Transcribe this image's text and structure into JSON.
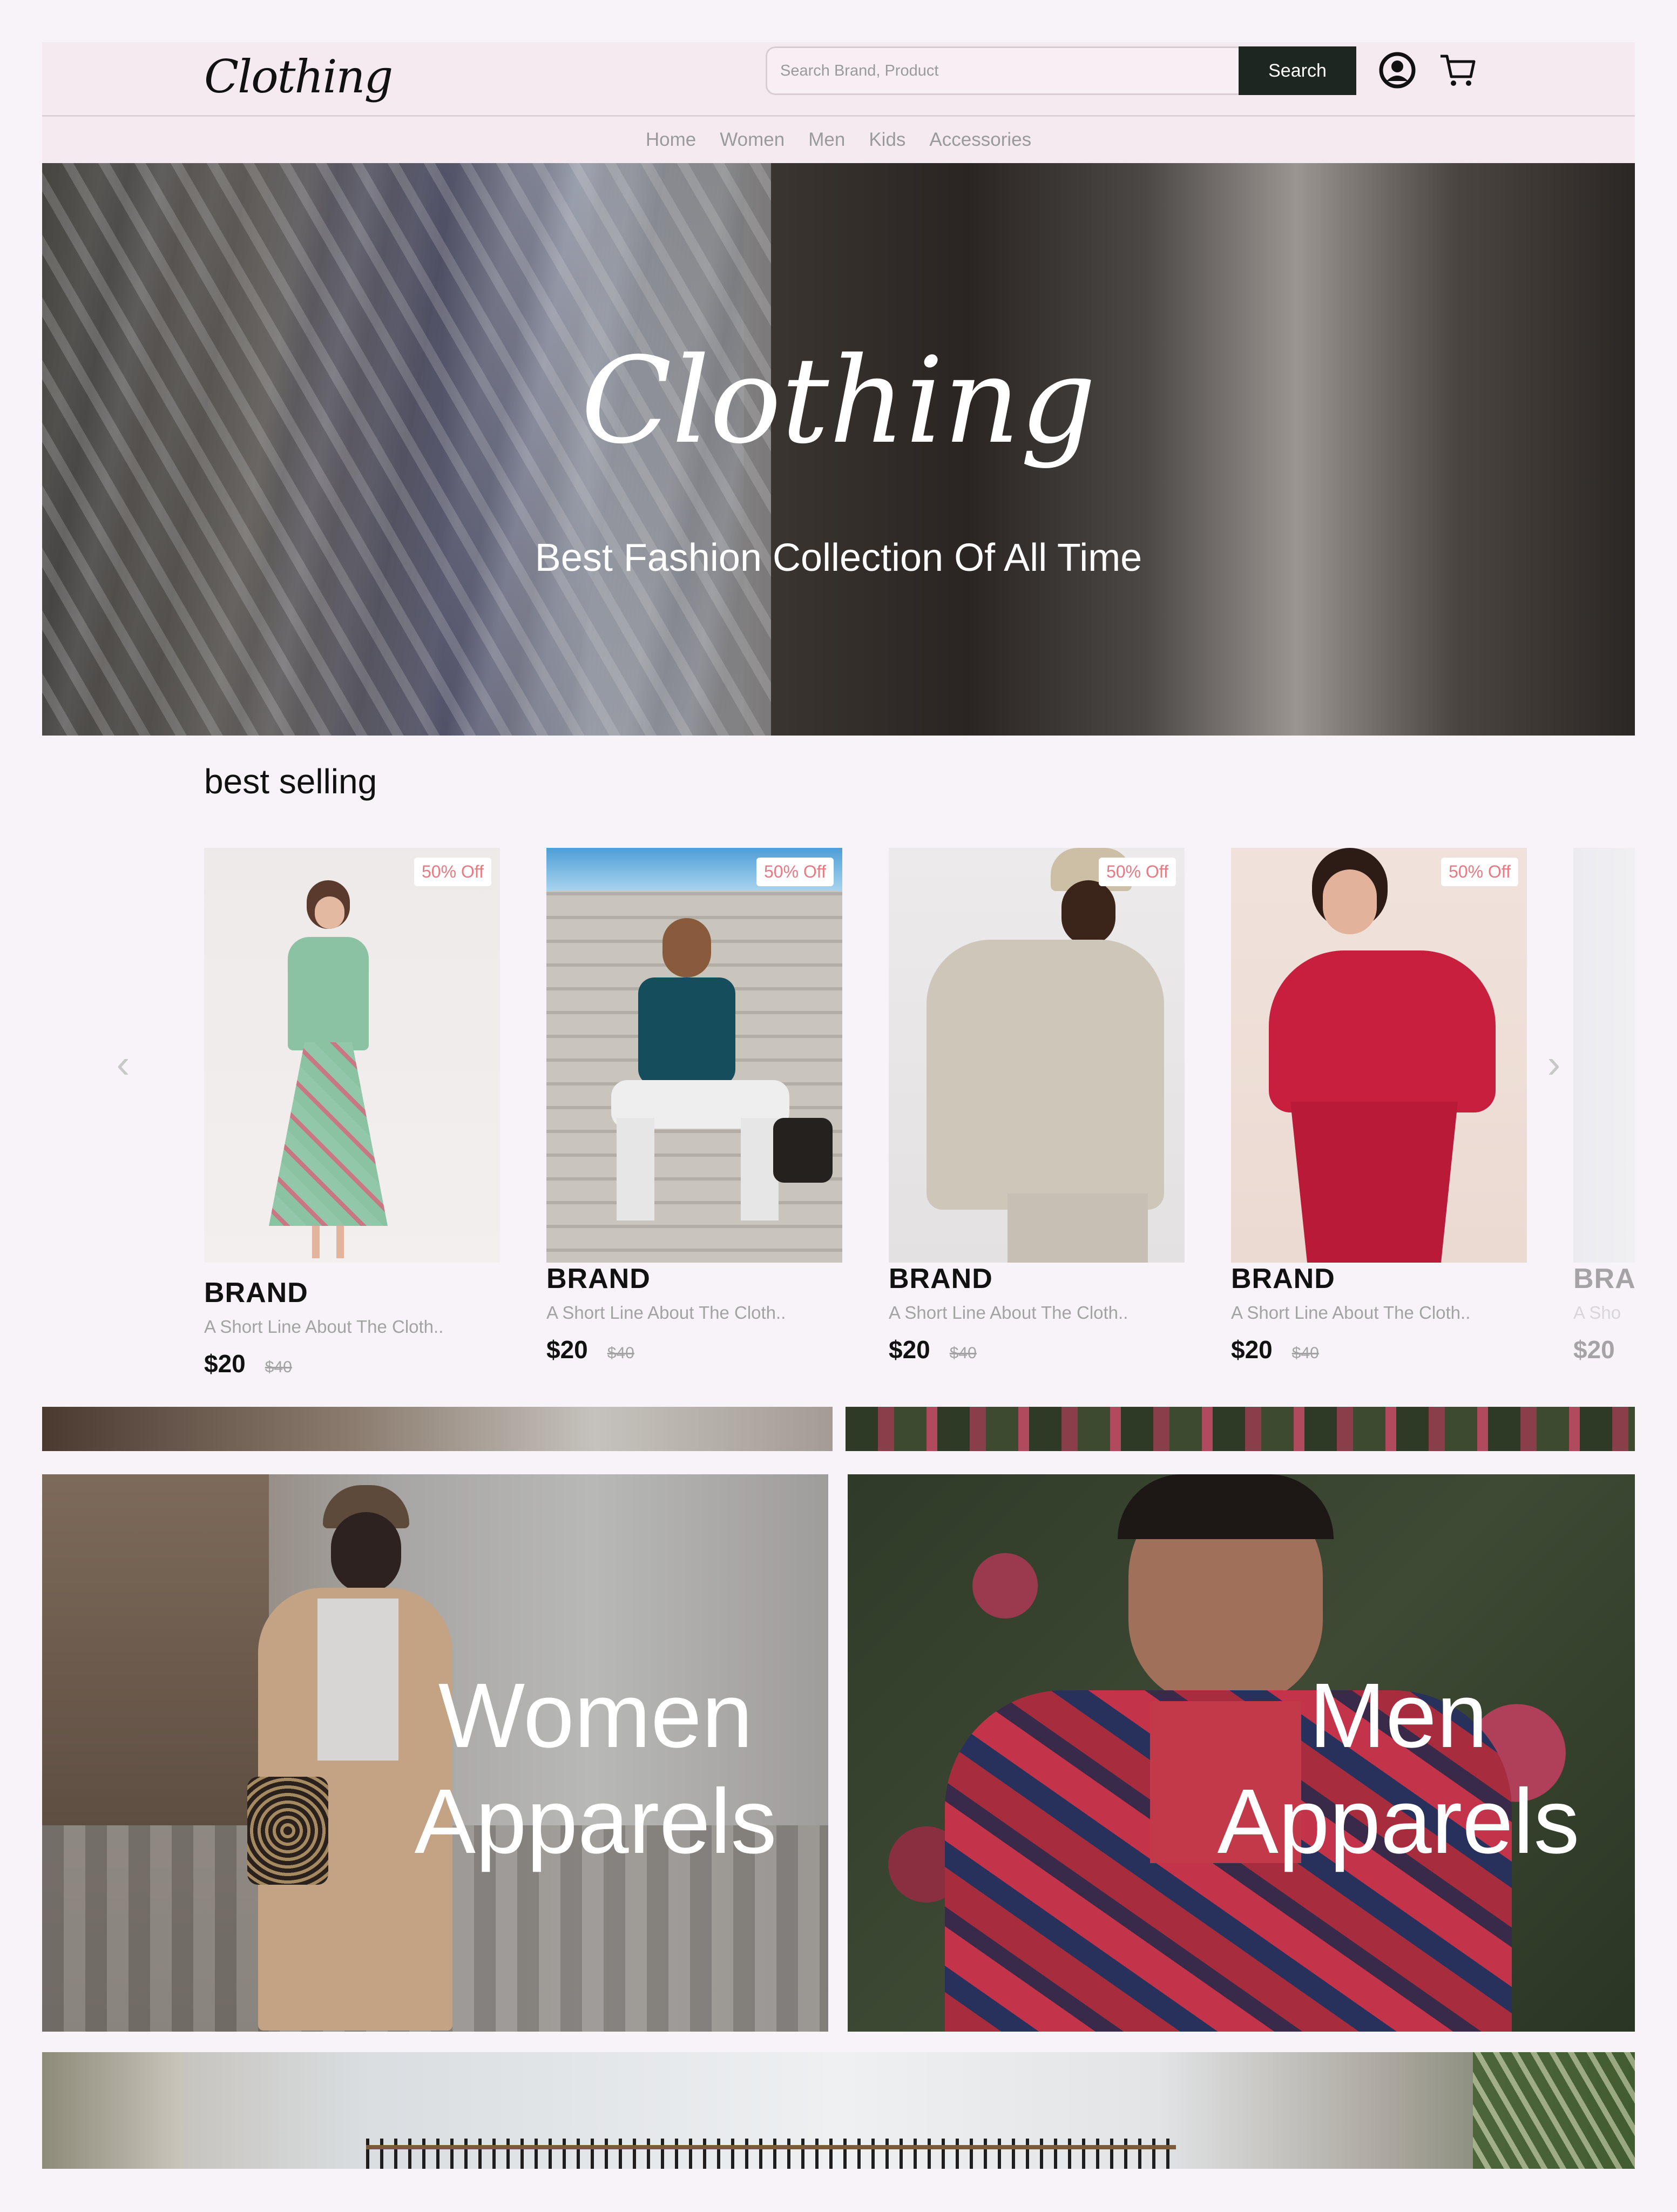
{
  "header": {
    "logo": "Clothing",
    "search_placeholder": "Search Brand, Product",
    "search_button": "Search",
    "icons": [
      "user-icon",
      "cart-icon"
    ]
  },
  "nav": {
    "items": [
      "Home",
      "Women",
      "Men",
      "Kids",
      "Accessories"
    ]
  },
  "hero": {
    "title": "Clothing",
    "subtitle": "Best Fashion Collection Of All Time"
  },
  "best_selling": {
    "title": "best selling",
    "products": [
      {
        "badge": "50% Off",
        "brand": "BRAND",
        "desc": "A Short Line About The Cloth..",
        "price": "$20",
        "old_price": "$40"
      },
      {
        "badge": "50% Off",
        "brand": "BRAND",
        "desc": "A Short Line About The Cloth..",
        "price": "$20",
        "old_price": "$40"
      },
      {
        "badge": "50% Off",
        "brand": "BRAND",
        "desc": "A Short Line About The Cloth..",
        "price": "$20",
        "old_price": "$40"
      },
      {
        "badge": "50% Off",
        "brand": "BRAND",
        "desc": "A Short Line About The Cloth..",
        "price": "$20",
        "old_price": "$40"
      },
      {
        "badge": "",
        "brand": "BRA",
        "desc": "A Sho",
        "price": "$20",
        "old_price": ""
      }
    ]
  },
  "categories": {
    "women": {
      "line1": "Women",
      "line2": "Apparels"
    },
    "men": {
      "line1": "Men",
      "line2": "Apparels"
    }
  },
  "colors": {
    "header_bg": "#f6eaf1",
    "search_button_bg": "#1d2620",
    "badge_text": "#e77a83",
    "page_bg": "#f7f3f8"
  }
}
